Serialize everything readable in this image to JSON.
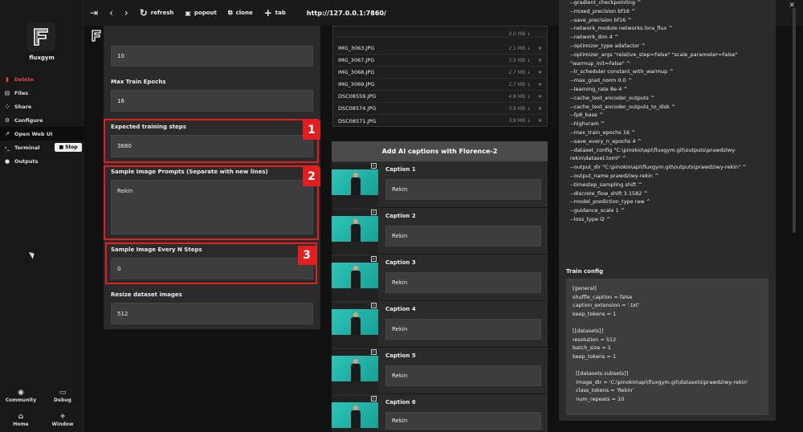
{
  "topbar": {
    "buttons": [
      {
        "icon": "exit-icon",
        "glyph": "⇥",
        "label": ""
      },
      {
        "icon": "back-icon",
        "glyph": "‹",
        "label": ""
      },
      {
        "icon": "forward-icon",
        "glyph": "›",
        "label": ""
      },
      {
        "icon": "refresh-icon",
        "glyph": "↻",
        "label": "refresh"
      },
      {
        "icon": "popout-icon",
        "glyph": "▣",
        "label": "popout"
      },
      {
        "icon": "clone-icon",
        "glyph": "⧉",
        "label": "clone"
      },
      {
        "icon": "plus-icon",
        "glyph": "+",
        "label": "tab"
      }
    ],
    "url": "http://127.0.0.1:7860/",
    "window_controls": [
      "—",
      "❐",
      "✕"
    ]
  },
  "sidebar": {
    "app_name": "fluxgym",
    "menu": [
      {
        "icon": "trash-icon",
        "glyph": "▮",
        "label": "Delete",
        "style": "red"
      },
      {
        "icon": "folder-icon",
        "glyph": "▤",
        "label": "Files",
        "style": ""
      },
      {
        "icon": "wifi-icon",
        "glyph": "⁘",
        "label": "Share",
        "style": ""
      },
      {
        "icon": "gear-icon",
        "glyph": "⚙",
        "label": "Configure",
        "style": ""
      },
      {
        "icon": "external-link-icon",
        "glyph": "↗",
        "label": "Open Web UI",
        "style": "active"
      },
      {
        "icon": "terminal-icon",
        "glyph": "›_",
        "label": "Terminal",
        "style": ""
      },
      {
        "icon": "user-icon",
        "glyph": "●",
        "label": "Outputs",
        "style": ""
      }
    ],
    "stop_label": "Stop",
    "bottom": [
      {
        "icon": "community-icon",
        "glyph": "◉",
        "label": "Community"
      },
      {
        "icon": "debug-icon",
        "glyph": "▭",
        "label": "Debug"
      },
      {
        "icon": "home-icon",
        "glyph": "⌂",
        "label": "Home"
      },
      {
        "icon": "plus-icon",
        "glyph": "+",
        "label": "Window"
      }
    ]
  },
  "form": {
    "field0_value": "10",
    "max_epochs_label": "Max Train Epochs",
    "max_epochs_value": "16",
    "expected_steps_label": "Expected training steps",
    "expected_steps_value": "3680",
    "prompts_label": "Sample Image Prompts (Separate with new lines)",
    "prompts_value": "Rekin",
    "every_n_label": "Sample Image Every N Steps",
    "every_n_value": "0",
    "resize_label": "Resize dataset images",
    "resize_value": "512"
  },
  "annotations": [
    "1",
    "2",
    "3"
  ],
  "files": [
    {
      "name": "IMG_3063.JPG",
      "size": "2.1 MB ↓",
      "close": "✕"
    },
    {
      "name": "IMG_3067.JPG",
      "size": "2.5 MB ↓",
      "close": "✕"
    },
    {
      "name": "IMG_3068.JPG",
      "size": "2.7 MB ↓",
      "close": "✕"
    },
    {
      "name": "IMG_3069.JPG",
      "size": "2.7 MB ↓",
      "close": "✕"
    },
    {
      "name": "DSC08559.JPG",
      "size": "4.8 MB ↓",
      "close": "✕"
    },
    {
      "name": "DSC08574.JPG",
      "size": "3.8 MB ↓",
      "close": "✕"
    },
    {
      "name": "DSC08571.JPG",
      "size": "3.9 MB ↓",
      "close": "✕"
    }
  ],
  "file_top_size": "2.0 MB ↓",
  "captions": {
    "header": "Add AI captions with Florence-2",
    "items": [
      {
        "label": "Caption 1",
        "value": "Rekin"
      },
      {
        "label": "Caption 2",
        "value": "Rekin"
      },
      {
        "label": "Caption 3",
        "value": "Rekin"
      },
      {
        "label": "Caption 4",
        "value": "Rekin"
      },
      {
        "label": "Caption 5",
        "value": "Rekin"
      },
      {
        "label": "Caption 6",
        "value": "Rekin"
      }
    ]
  },
  "script_text": "--gradient_checkpointing ^\n--mixed_precision bf16 ^\n--save_precision bf16 ^\n--network_module networks.lora_flux ^\n--network_dim 4 ^\n--optimizer_type adafactor ^\n--optimizer_args \"relative_step=False\" \"scale_parameter=False\"\n\"warmup_init=False\" ^\n--lr_scheduler constant_with_warmup ^\n--max_grad_norm 0.0 ^\n--learning_rate 8e-4 ^\n--cache_text_encoder_outputs ^\n--cache_text_encoder_outputs_to_disk ^\n--fp8_base ^\n--highvram ^\n--max_train_epochs 16 ^\n--save_every_n_epochs 4 ^\n--dataset_config \"C:\\pinokio\\api\\fluxgym.git\\outputs\\prawdziwy-\nrekin\\dataset.toml\" ^\n--output_dir \"C:\\pinokio\\api\\fluxgym.git\\outputs\\prawdziwy-rekin\" ^\n--output_name prawdziwy-rekin ^\n--timestep_sampling shift ^\n--discrete_flow_shift 3.1582 ^\n--model_prediction_type raw ^\n--guidance_scale 1 ^\n--loss_type l2 ^",
  "train_config": {
    "label": "Train config",
    "text": "[general]\nshuffle_caption = false\ncaption_extension = '.txt'\nkeep_tokens = 1\n\n[[datasets]]\nresolution = 512\nbatch_size = 1\nkeep_tokens = 1\n\n  [[datasets.subsets]]\n  image_dir = 'C:\\pinokio\\api\\fluxgym.git\\datasets\\prawdziwy-rekin'\n  class_tokens = 'Rekin'\n  num_repeats = 10"
  }
}
